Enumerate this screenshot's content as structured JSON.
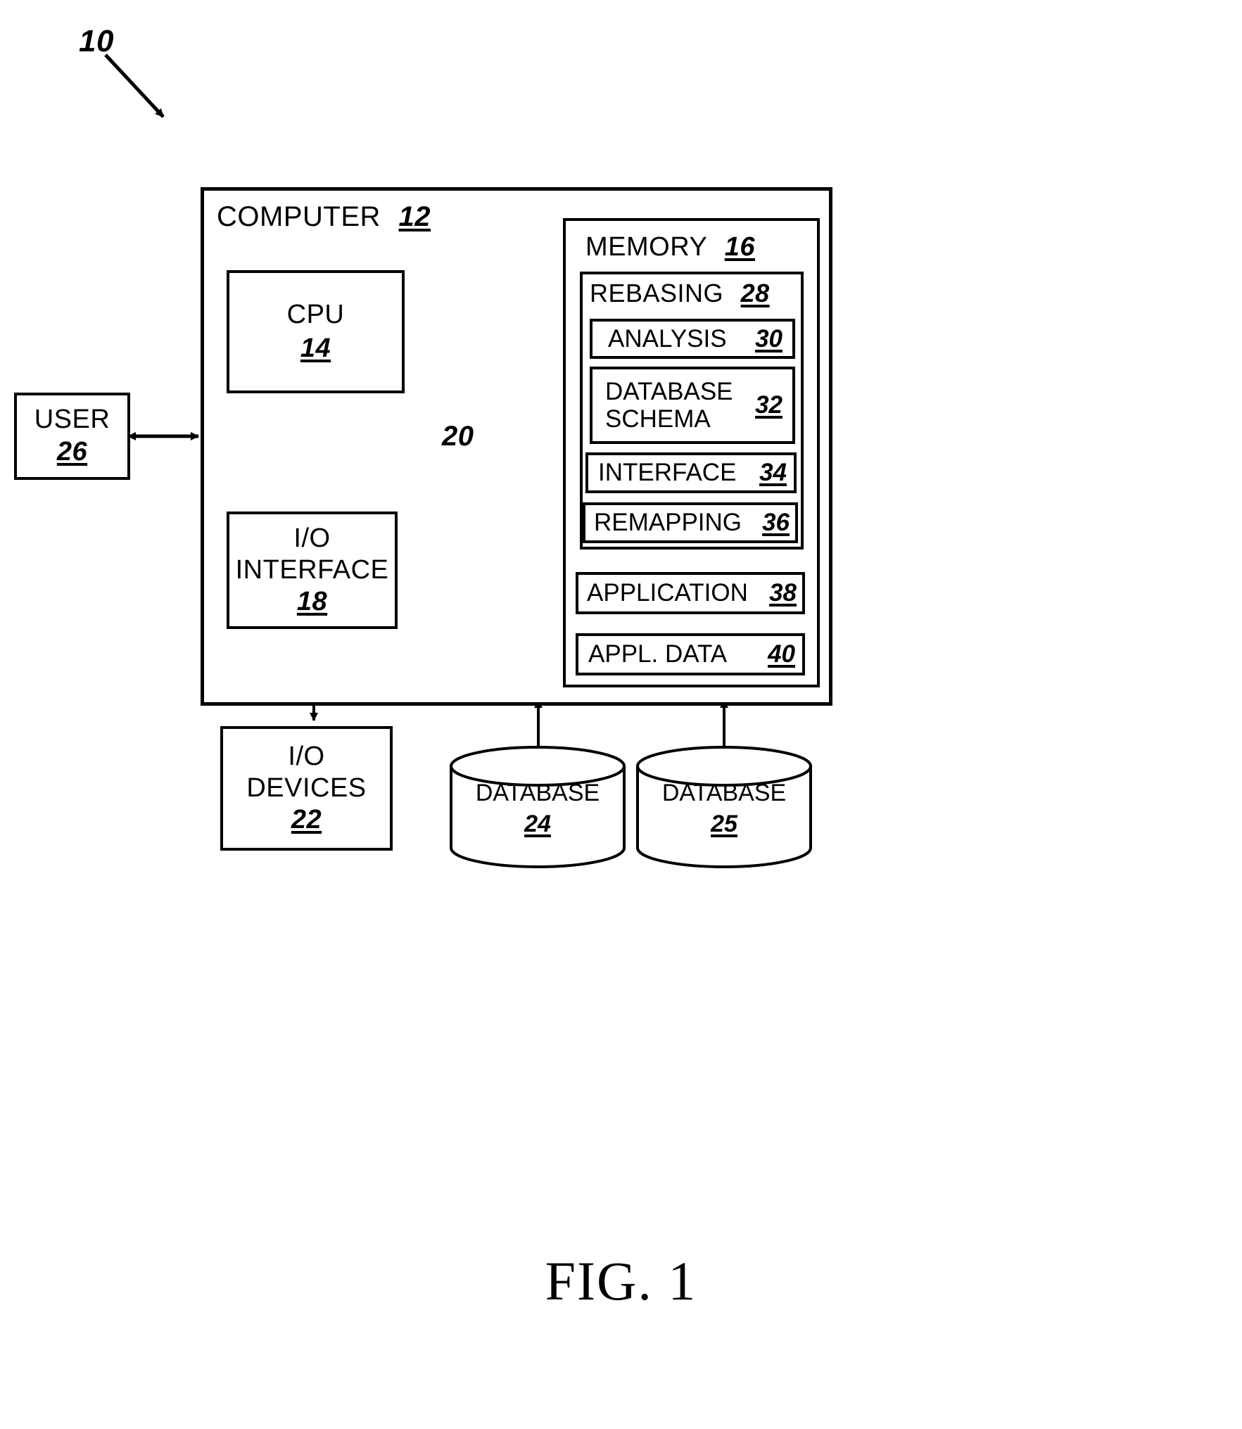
{
  "figure": {
    "caption": "FIG. 1",
    "system_ref": "10"
  },
  "computer": {
    "title": "COMPUTER",
    "ref": "12"
  },
  "cpu": {
    "label": "CPU",
    "ref": "14"
  },
  "io_interface": {
    "line1": "I/O",
    "line2": "INTERFACE",
    "ref": "18"
  },
  "io_devices": {
    "line1": "I/O",
    "line2": "DEVICES",
    "ref": "22"
  },
  "user": {
    "label": "USER",
    "ref": "26"
  },
  "bus": {
    "ref": "20"
  },
  "memory": {
    "title": "MEMORY",
    "ref": "16",
    "rebasing": {
      "title": "REBASING",
      "ref": "28",
      "items": [
        {
          "label": "ANALYSIS",
          "ref": "30"
        },
        {
          "label": "DATABASE SCHEMA",
          "ref": "32"
        },
        {
          "label": "INTERFACE",
          "ref": "34"
        },
        {
          "label": "REMAPPING",
          "ref": "36"
        }
      ]
    },
    "items": [
      {
        "label": "APPLICATION",
        "ref": "38"
      },
      {
        "label": "APPL. DATA",
        "ref": "40"
      }
    ]
  },
  "databases": [
    {
      "label": "DATABASE",
      "ref": "24"
    },
    {
      "label": "DATABASE",
      "ref": "25"
    }
  ]
}
